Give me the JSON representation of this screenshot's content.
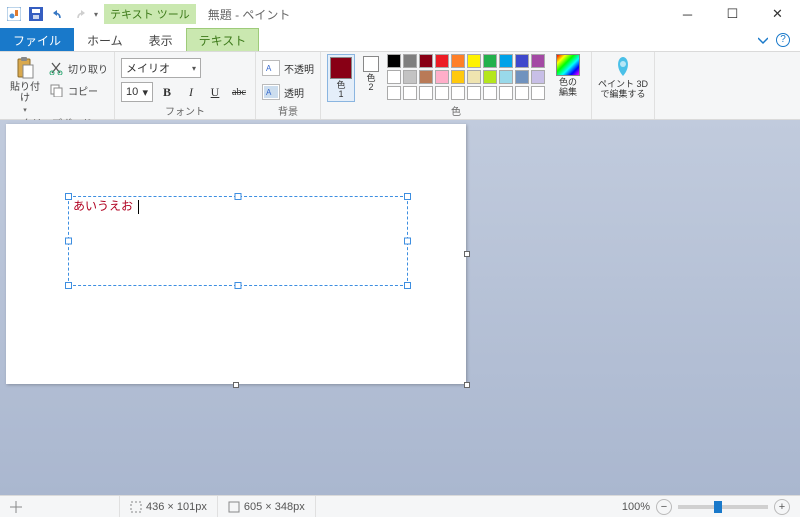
{
  "titlebar": {
    "contextual_tool_label": "テキスト ツール",
    "title": "無題 - ペイント"
  },
  "tabs": {
    "file": "ファイル",
    "home": "ホーム",
    "view": "表示",
    "text": "テキスト"
  },
  "ribbon": {
    "clipboard": {
      "paste": "貼り付け",
      "cut": "切り取り",
      "copy": "コピー",
      "group_label": "クリップボード"
    },
    "font": {
      "selected_font": "メイリオ",
      "selected_size": "10",
      "group_label": "フォント"
    },
    "background": {
      "opaque": "不透明",
      "transparent": "透明",
      "group_label": "背景"
    },
    "colors": {
      "color1_label": "色\n1",
      "color2_label": "色\n2",
      "edit_colors": "色の\n編集",
      "group_label": "色",
      "color1_value": "#880015",
      "color2_value": "#ffffff",
      "palette_row1": [
        "#000000",
        "#7f7f7f",
        "#880015",
        "#ed1c24",
        "#ff7f27",
        "#fff200",
        "#22b14c",
        "#00a2e8",
        "#3f48cc",
        "#a349a4"
      ],
      "palette_row2": [
        "#ffffff",
        "#c3c3c3",
        "#b97a57",
        "#ffaec9",
        "#ffc90e",
        "#efe4b0",
        "#b5e61d",
        "#99d9ea",
        "#7092be",
        "#c8bfe7"
      ],
      "palette_row3": [
        "#ffffff",
        "#ffffff",
        "#ffffff",
        "#ffffff",
        "#ffffff",
        "#ffffff",
        "#ffffff",
        "#ffffff",
        "#ffffff",
        "#ffffff"
      ]
    },
    "paint3d": {
      "label": "ペイント 3D\nで編集する"
    }
  },
  "canvas": {
    "text_content": "あいうえお"
  },
  "statusbar": {
    "selection_size": "436 × 101px",
    "canvas_size": "605 × 348px",
    "zoom": "100%"
  }
}
